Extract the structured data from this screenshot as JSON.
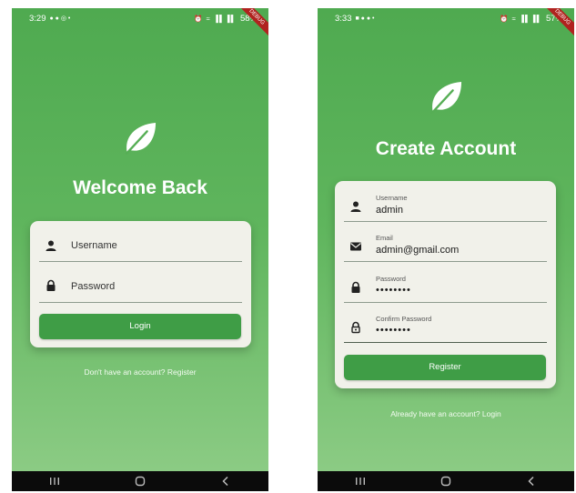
{
  "login": {
    "status": {
      "time": "3:29",
      "battery": "58%",
      "icons": "⏰ ≈ ▐▌▐▌"
    },
    "debug_banner": "DEBUG",
    "title": "Welcome Back",
    "fields": {
      "username_placeholder": "Username",
      "password_placeholder": "Password"
    },
    "button_label": "Login",
    "footer_link": "Don't have an account? Register"
  },
  "register": {
    "status": {
      "time": "3:33",
      "battery": "57%",
      "icons": "⏰ ≈ ▐▌▐▌"
    },
    "debug_banner": "DEBUG",
    "title": "Create Account",
    "fields": {
      "username": {
        "label": "Username",
        "value": "admin"
      },
      "email": {
        "label": "Email",
        "value": "admin@gmail.com"
      },
      "password": {
        "label": "Password",
        "value": "••••••••"
      },
      "confirm_password": {
        "label": "Confirm Password",
        "value": "••••••••"
      }
    },
    "button_label": "Register",
    "footer_link": "Already have an account? Login"
  },
  "colors": {
    "primary": "#3f9d46",
    "background_top": "#4faa50",
    "background_bottom": "#8fcd87",
    "card": "#f1f1ea",
    "debug_banner": "#b0231f"
  }
}
